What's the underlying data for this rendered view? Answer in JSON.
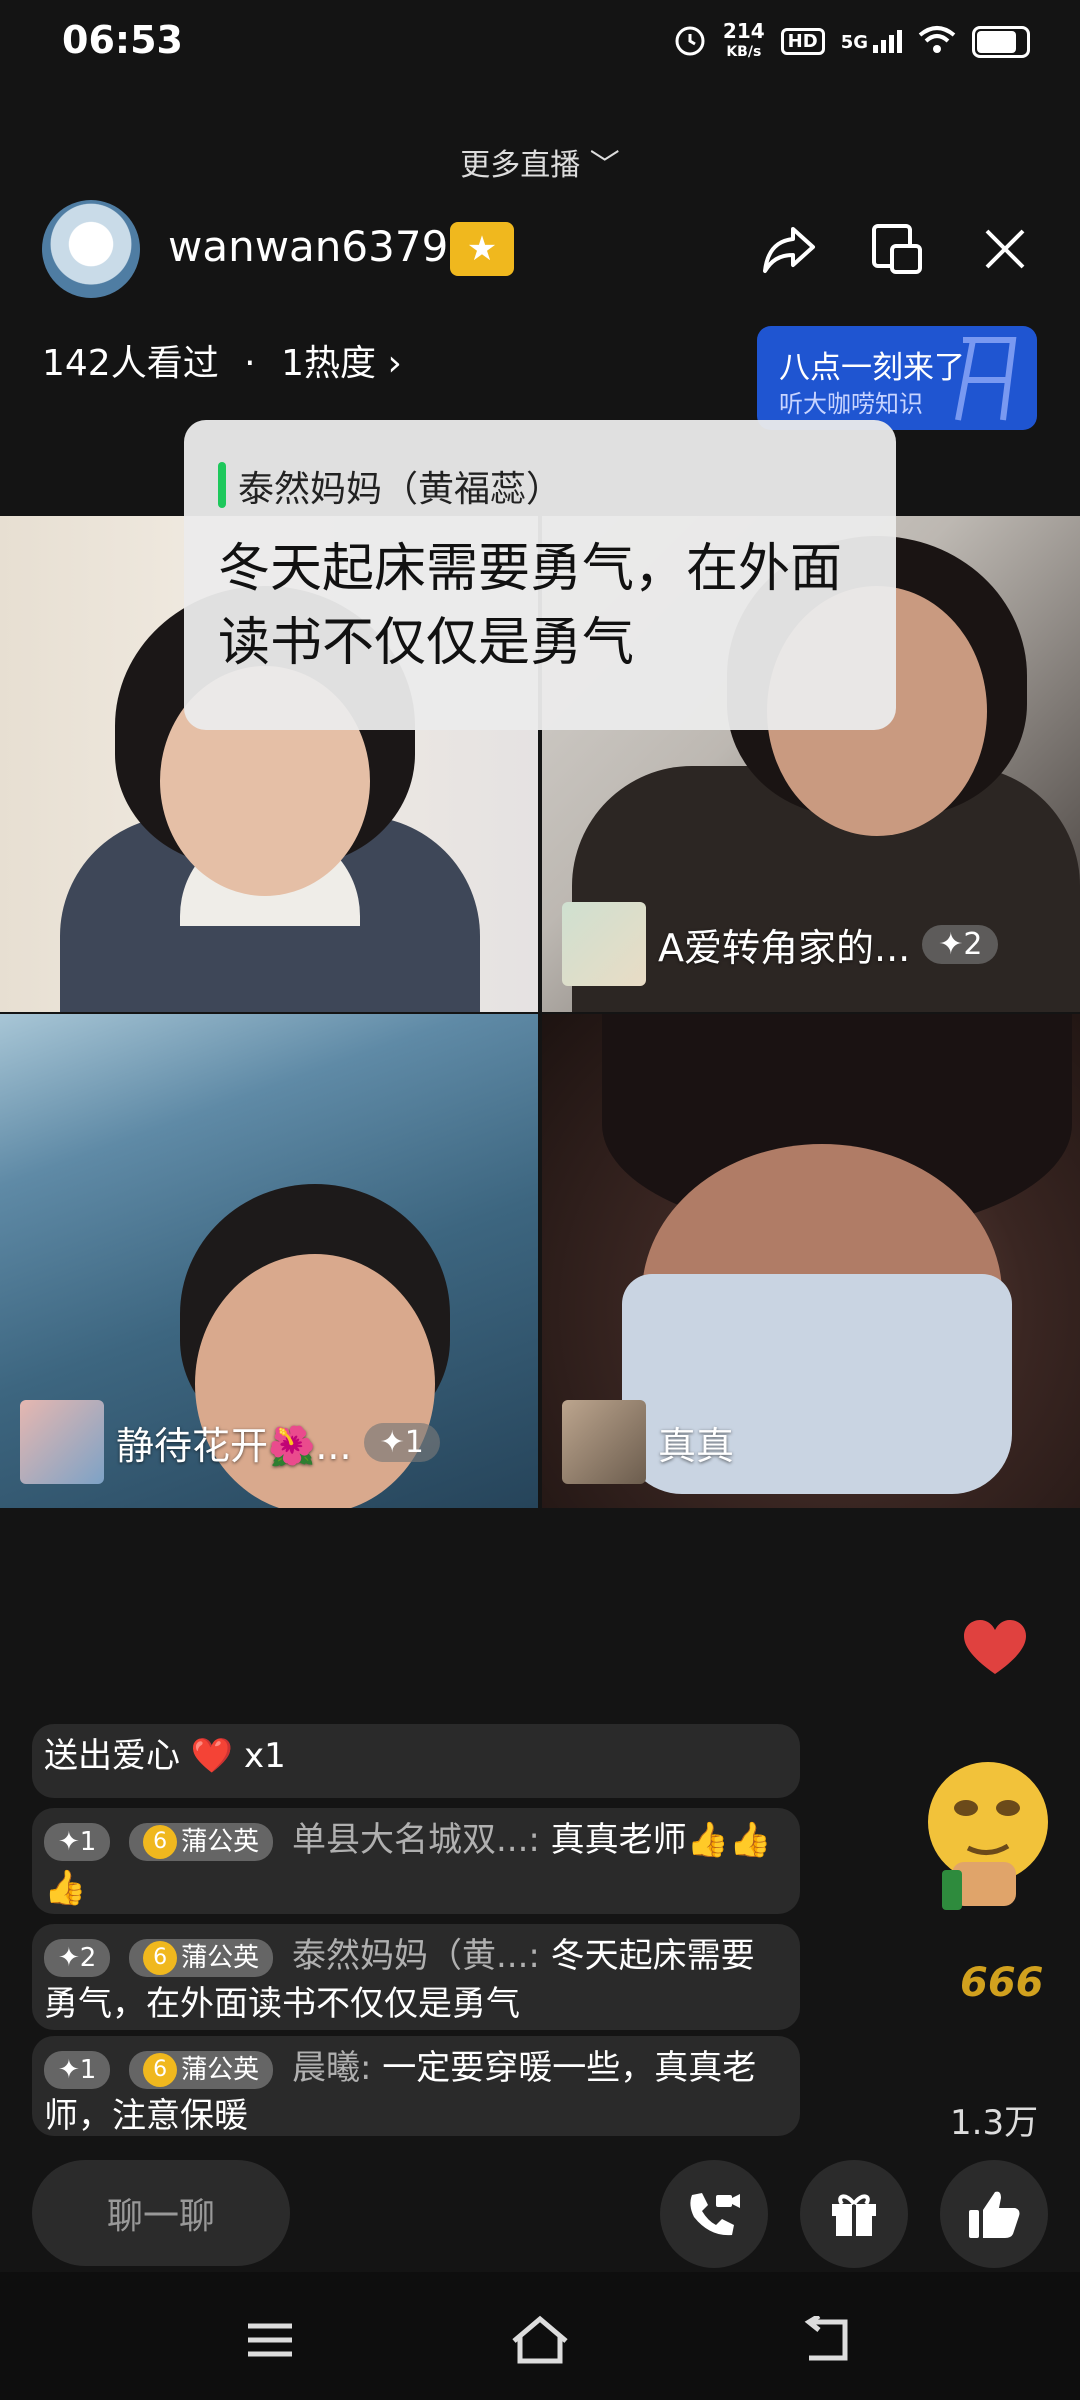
{
  "status_bar": {
    "time": "06:53",
    "net_speed_value": "214",
    "net_speed_unit": "KB/s",
    "hd": "HD",
    "network": "5G"
  },
  "header": {
    "more_live": "更多直播",
    "host_name": "wanwan6379",
    "viewers": "142人看过",
    "separator": "·",
    "heat": "1热度",
    "promo_title": "八点一刻来了",
    "promo_subtitle": "听大咖唠知识"
  },
  "bubble": {
    "speaker": "泰然妈妈（黄福蕊）",
    "text": "冬天起床需要勇气，在外面读书不仅仅是勇气"
  },
  "tiles": [
    {
      "name": "A爱转角家的...",
      "badge": "✦2"
    },
    {
      "name": "静待花开🌺...",
      "badge": "✦1"
    },
    {
      "name": "真真",
      "badge": ""
    }
  ],
  "chat": [
    {
      "text": "送出爱心 ❤️ x1"
    },
    {
      "badge": "✦1",
      "level": "6",
      "tag": "蒲公英",
      "user": "单县大名城双...:",
      "message": "真真老师👍👍👍"
    },
    {
      "badge": "✦2",
      "level": "6",
      "tag": "蒲公英",
      "user": "泰然妈妈（黄...:",
      "message": "冬天起床需要勇气，在外面读书不仅仅是勇气"
    },
    {
      "badge": "✦1",
      "level": "6",
      "tag": "蒲公英",
      "user": "晨曦:",
      "message": "一定要穿暖一些，真真老师，注意保暖"
    }
  ],
  "side": {
    "six": "666",
    "likes": "1.3万"
  },
  "bottom": {
    "chat_placeholder": "聊一聊"
  },
  "icons": [
    "share-icon",
    "window-icon",
    "close-icon",
    "heart-icon",
    "video-call-icon",
    "gift-icon",
    "thumbs-up-icon",
    "menu-icon",
    "home-icon",
    "back-icon"
  ],
  "colors": {
    "promo": "#1f55d1",
    "badge_gold": "#f0b81e",
    "speaker_bar": "#1ec85c",
    "heart": "#e0413f"
  }
}
